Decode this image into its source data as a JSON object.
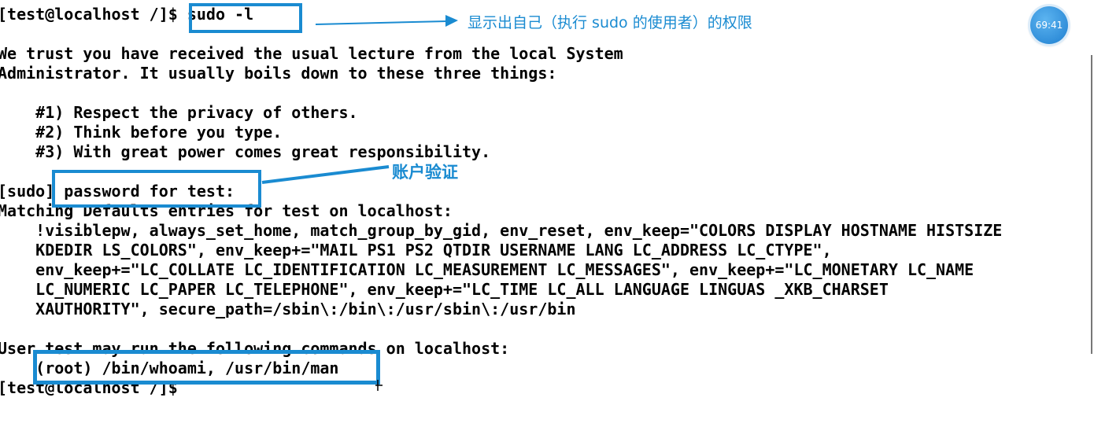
{
  "terminal": {
    "lines": [
      "[test@localhost /]$ sudo -l",
      "",
      "We trust you have received the usual lecture from the local System",
      "Administrator. It usually boils down to these three things:",
      "",
      "    #1) Respect the privacy of others.",
      "    #2) Think before you type.",
      "    #3) With great power comes great responsibility.",
      "",
      "[sudo] password for test:",
      "Matching Defaults entries for test on localhost:",
      "    !visiblepw, always_set_home, match_group_by_gid, env_reset, env_keep=\"COLORS DISPLAY HOSTNAME HISTSIZE",
      "    KDEDIR LS_COLORS\", env_keep+=\"MAIL PS1 PS2 QTDIR USERNAME LANG LC_ADDRESS LC_CTYPE\",",
      "    env_keep+=\"LC_COLLATE LC_IDENTIFICATION LC_MEASUREMENT LC_MESSAGES\", env_keep+=\"LC_MONETARY LC_NAME",
      "    LC_NUMERIC LC_PAPER LC_TELEPHONE\", env_keep+=\"LC_TIME LC_ALL LANGUAGE LINGUAS _XKB_CHARSET",
      "    XAUTHORITY\", secure_path=/sbin\\:/bin\\:/usr/sbin\\:/usr/bin",
      "",
      "User test may run the following commands on localhost:",
      "    (root) /bin/whoami, /usr/bin/man",
      "[test@localhost /]$"
    ]
  },
  "annotations": {
    "command_note": "显示出自己（执行 sudo 的使用者）的权限",
    "password_note": "账户验证"
  },
  "badge": {
    "value": "69:41"
  },
  "colors": {
    "annotation": "#1a8bd1",
    "text": "#000000",
    "background": "#ffffff"
  }
}
